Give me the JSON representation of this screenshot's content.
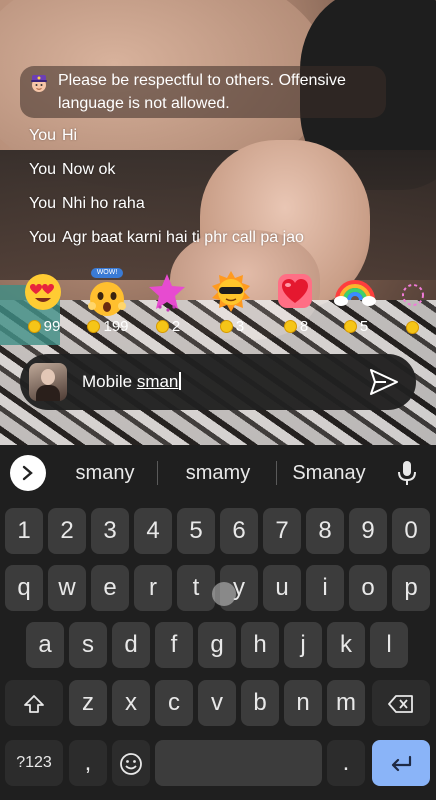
{
  "notice": {
    "text": "Please be respectful to others. Offensive language is not allowed.",
    "icon": "police-officer-icon"
  },
  "chat": [
    {
      "user": "You",
      "message": "Hi"
    },
    {
      "user": "You",
      "message": "Now ok"
    },
    {
      "user": "You",
      "message": "Nhi ho raha"
    },
    {
      "user": "You",
      "message": "Agr baat karni hai ti phr call pa jao"
    }
  ],
  "gifts": [
    {
      "icon": "heart-eyes-emoji-icon",
      "price": "99"
    },
    {
      "icon": "wow-face-emoji-icon",
      "price": "199",
      "badge": "WOW!"
    },
    {
      "icon": "pink-star-icon",
      "price": "2"
    },
    {
      "icon": "cool-sun-icon",
      "price": "3"
    },
    {
      "icon": "red-heart-icon",
      "price": "8"
    },
    {
      "icon": "rainbow-icon",
      "price": "5"
    }
  ],
  "input": {
    "value_plain": "Mobile ",
    "value_composing": "sman"
  },
  "suggestions": [
    "smany",
    "smamy",
    "Smanay"
  ],
  "keyboard": {
    "numbers": [
      "1",
      "2",
      "3",
      "4",
      "5",
      "6",
      "7",
      "8",
      "9",
      "0"
    ],
    "row1": [
      "q",
      "w",
      "e",
      "r",
      "t",
      "y",
      "u",
      "i",
      "o",
      "p"
    ],
    "row2": [
      "a",
      "s",
      "d",
      "f",
      "g",
      "h",
      "j",
      "k",
      "l"
    ],
    "row3": [
      "z",
      "x",
      "c",
      "v",
      "b",
      "n",
      "m"
    ],
    "symbols_label": "?123",
    "comma": ",",
    "period": "."
  },
  "colors": {
    "keyboard_bg": "#1f1f1f",
    "key_bg": "#3c3c3c",
    "enter_key": "#8ab4f8",
    "coin": "#f5c518"
  }
}
